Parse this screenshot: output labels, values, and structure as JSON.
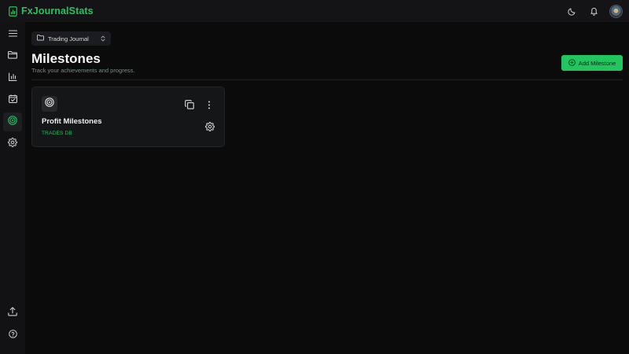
{
  "app": {
    "name": "FxJournalStats"
  },
  "topbar": {
    "icons": [
      "theme-toggle-icon",
      "bell-icon",
      "avatar"
    ]
  },
  "sidebar": {
    "items": [
      {
        "icon": "menu-icon"
      },
      {
        "icon": "folder-icon"
      },
      {
        "icon": "bar-chart-icon"
      },
      {
        "icon": "calendar-check-icon"
      },
      {
        "icon": "target-icon",
        "active": true
      },
      {
        "icon": "settings-icon"
      }
    ],
    "bottom_items": [
      {
        "icon": "upload-icon"
      },
      {
        "icon": "help-icon"
      }
    ]
  },
  "main": {
    "journal_selector": "Trading Journal",
    "title": "Milestones",
    "subtitle": "Track your achievements and progress.",
    "add_button": "Add Milestone"
  },
  "cards": [
    {
      "title": "Profit Milestones",
      "source": "TRADES DB"
    }
  ],
  "colors": {
    "accent": "#22c55e",
    "background": "#0b0b0c",
    "panel": "#151618"
  }
}
